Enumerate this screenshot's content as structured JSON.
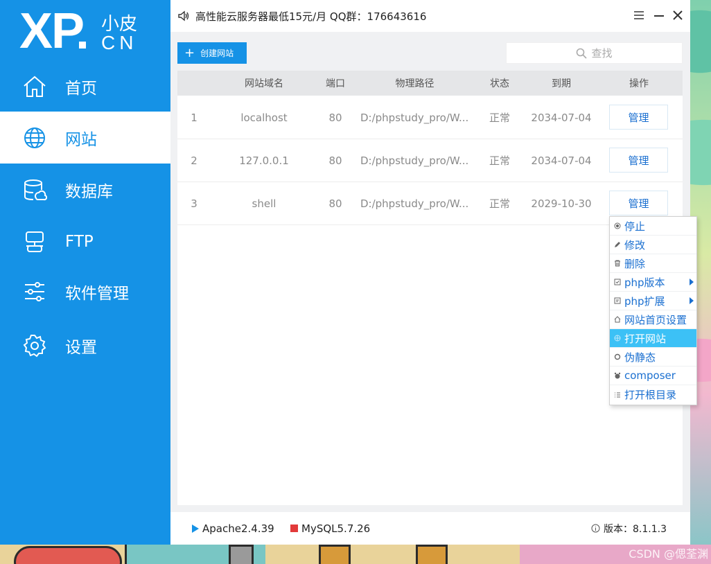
{
  "logo": {
    "main": "XP",
    "cn_top": "小皮",
    "cn_bottom": "CN"
  },
  "sidebar": {
    "items": [
      {
        "label": "首页",
        "icon": "home-icon"
      },
      {
        "label": "网站",
        "icon": "globe-icon"
      },
      {
        "label": "数据库",
        "icon": "database-icon"
      },
      {
        "label": "FTP",
        "icon": "ftp-icon"
      },
      {
        "label": "软件管理",
        "icon": "sliders-icon"
      },
      {
        "label": "设置",
        "icon": "gear-icon"
      }
    ]
  },
  "topbar": {
    "announcement": "高性能云服务器最低15元/月  QQ群：176643616"
  },
  "toolbar": {
    "create_label": "创建网站",
    "search_placeholder": "查找"
  },
  "table": {
    "headers": [
      "网站域名",
      "端口",
      "物理路径",
      "状态",
      "到期",
      "操作"
    ],
    "rows": [
      {
        "no": "1",
        "domain": "localhost",
        "port": "80",
        "path": "D:/phpstudy_pro/W...",
        "status": "正常",
        "expire": "2034-07-04",
        "action": "管理"
      },
      {
        "no": "2",
        "domain": "127.0.0.1",
        "port": "80",
        "path": "D:/phpstudy_pro/W...",
        "status": "正常",
        "expire": "2034-07-04",
        "action": "管理"
      },
      {
        "no": "3",
        "domain": "shell",
        "port": "80",
        "path": "D:/phpstudy_pro/W...",
        "status": "正常",
        "expire": "2029-10-30",
        "action": "管理"
      }
    ]
  },
  "context_menu": {
    "items": [
      {
        "label": "停止",
        "icon": "stop-icon"
      },
      {
        "label": "修改",
        "icon": "pencil-icon"
      },
      {
        "label": "删除",
        "icon": "trash-icon"
      },
      {
        "label": "php版本",
        "icon": "php-version-icon",
        "submenu": true
      },
      {
        "label": "php扩展",
        "icon": "php-extension-icon",
        "submenu": true
      },
      {
        "label": "网站首页设置",
        "icon": "home-small-icon"
      },
      {
        "label": "打开网站",
        "icon": "globe-small-icon",
        "highlighted": true
      },
      {
        "label": "伪静态",
        "icon": "rewrite-icon"
      },
      {
        "label": "composer",
        "icon": "composer-icon"
      },
      {
        "label": "打开根目录",
        "icon": "list-icon"
      }
    ]
  },
  "status": {
    "apache": "Apache2.4.39",
    "mysql": "MySQL5.7.26",
    "version_label": "版本：8.1.1.3"
  },
  "watermark": "CSDN @偲荃渊",
  "colors": {
    "sidebar": "#1592e6",
    "accent": "#1592e6",
    "menu_highlight": "#3cc1f6",
    "apache_running": "#1592e6",
    "mysql_stopped": "#e23a3a"
  }
}
